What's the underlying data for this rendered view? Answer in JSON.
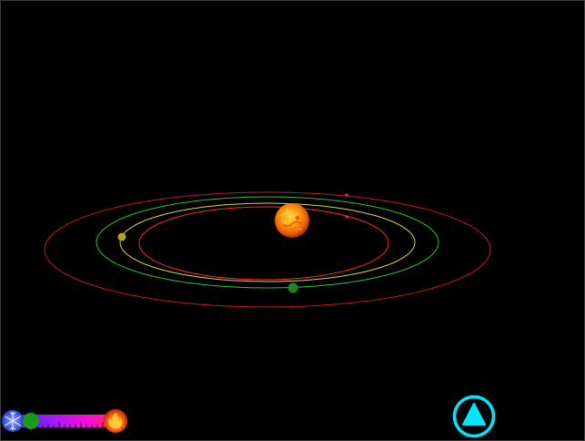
{
  "scene": {
    "sun": {
      "name": "sun-icon",
      "color": "#ff8a00"
    },
    "orbits": [
      {
        "name": "inner-red-orbit",
        "color": "#ff2a2a"
      },
      {
        "name": "yellow-orbit",
        "color": "#d8d83a"
      },
      {
        "name": "green-orbit",
        "color": "#2fbf2f"
      },
      {
        "name": "outer-red-orbit",
        "color": "#c81818"
      }
    ],
    "planets": [
      {
        "name": "yellow-planet",
        "color": "#b8a020"
      },
      {
        "name": "green-planet",
        "color": "#1c8a1c"
      },
      {
        "name": "red-marker-top",
        "color": "#ff2020"
      },
      {
        "name": "red-marker-mid",
        "color": "#ff2020"
      }
    ]
  },
  "controls": {
    "temperature_slider": {
      "cold_icon": "snowflake-icon",
      "hot_icon": "fire-icon",
      "level": 0.15,
      "gradient": [
        "#3a2bff",
        "#9a1cff",
        "#ff0fd0",
        "#ff2a60"
      ]
    },
    "up_button": {
      "icon": "up-triangle-icon",
      "color": "#00e6ff"
    }
  }
}
